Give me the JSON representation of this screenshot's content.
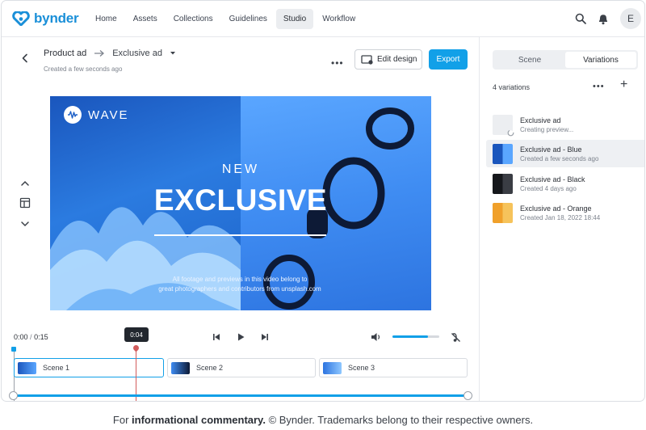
{
  "brand": {
    "name": "bynder",
    "color": "#1a8fd8"
  },
  "nav": {
    "items": [
      {
        "label": "Home",
        "active": false
      },
      {
        "label": "Assets",
        "active": false
      },
      {
        "label": "Collections",
        "active": false
      },
      {
        "label": "Guidelines",
        "active": false
      },
      {
        "label": "Studio",
        "active": true
      },
      {
        "label": "Workflow",
        "active": false
      }
    ],
    "avatar_initial": "E",
    "icons": [
      "search-icon",
      "bell-icon"
    ]
  },
  "header": {
    "parent": "Product ad",
    "current": "Exclusive ad",
    "created": "Created a few seconds ago",
    "edit_label": "Edit design",
    "export_label": "Export",
    "accent": "#12a0e8"
  },
  "preview": {
    "brand": "WAVE",
    "line1": "NEW",
    "line2": "EXCLUSIVE",
    "credit_line1": "All footage and previews in this video belong to",
    "credit_line2": "great photographers and contributors from unsplash.com"
  },
  "player": {
    "current_time": "0:00",
    "separator": "/",
    "duration": "0:15",
    "playhead_time": "0:04",
    "volume": 0.75
  },
  "scenes": [
    {
      "label": "Scene 1",
      "active": true
    },
    {
      "label": "Scene 2",
      "active": false
    },
    {
      "label": "Scene 3",
      "active": false
    }
  ],
  "panel": {
    "tabs": [
      {
        "label": "Scene",
        "active": false
      },
      {
        "label": "Variations",
        "active": true
      }
    ],
    "count_label": "4 variations",
    "variations": [
      {
        "title": "Exclusive ad",
        "subtitle": "Creating preview...",
        "selected": false,
        "thumb": "placeholder"
      },
      {
        "title": "Exclusive ad - Blue",
        "subtitle": "Created a few seconds ago",
        "selected": true,
        "thumb": "blue"
      },
      {
        "title": "Exclusive ad - Black",
        "subtitle": "Created 4 days ago",
        "selected": false,
        "thumb": "black"
      },
      {
        "title": "Exclusive ad - Orange",
        "subtitle": "Created Jan 18, 2022 18:44",
        "selected": false,
        "thumb": "orange"
      }
    ]
  },
  "footer": {
    "prefix": "For",
    "bold": "informational commentary.",
    "rest": "© Bynder. Trademarks belong to their respective owners."
  }
}
